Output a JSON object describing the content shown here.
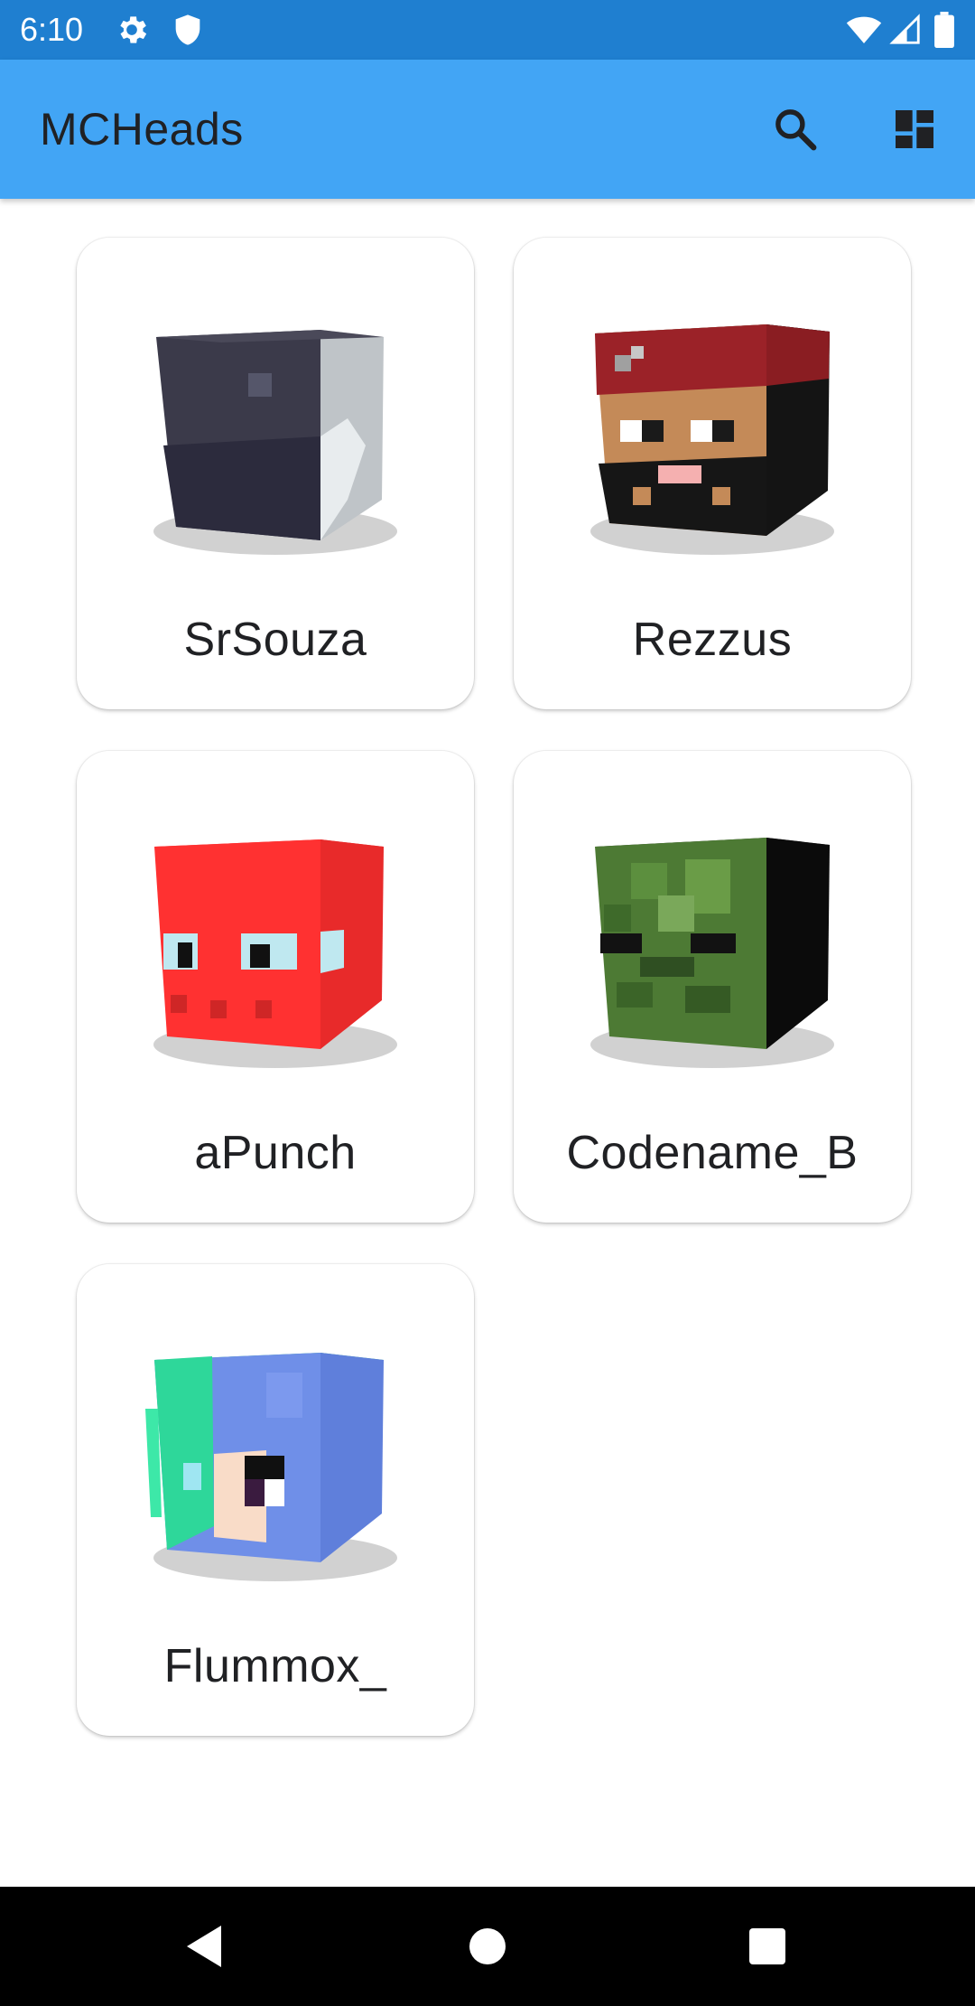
{
  "status_bar": {
    "time": "6:10",
    "icons_left": [
      "settings-icon",
      "shield-icon"
    ],
    "icons_right": [
      "wifi-icon",
      "signal-icon",
      "battery-icon"
    ]
  },
  "app_bar": {
    "title": "MCHeads",
    "actions": [
      "search-icon",
      "dashboard-icon"
    ],
    "color": "#42a5f5"
  },
  "heads": [
    {
      "name": "SrSouza"
    },
    {
      "name": "Rezzus"
    },
    {
      "name": "aPunch"
    },
    {
      "name": "Codename_B"
    },
    {
      "name": "Flummox_"
    }
  ],
  "nav_bar": {
    "buttons": [
      "back-icon",
      "home-icon",
      "recents-icon"
    ]
  }
}
